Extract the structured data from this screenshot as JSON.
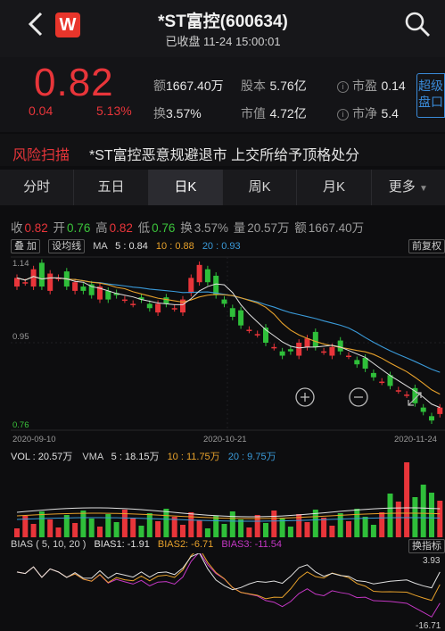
{
  "header": {
    "back_icon": "chevron-left-icon",
    "logo_text": "W",
    "title": "*ST富控(600634)",
    "subtitle": "已收盘 11-24 15:00:01",
    "search_icon": "search-icon"
  },
  "quote": {
    "price": "0.82",
    "change": "0.04",
    "change_pct": "5.13%",
    "amount_label": "额",
    "amount": "1667.40万",
    "capital_label": "股本",
    "capital": "5.76亿",
    "pe_label": "市盈",
    "pe": "0.14",
    "turnover_label": "换",
    "turnover": "3.57%",
    "mktcap_label": "市值",
    "mktcap": "4.72亿",
    "pb_label": "市净",
    "pb": "5.4",
    "super_button": "超级盘口"
  },
  "risk": {
    "label": "风险扫描",
    "text": "*ST富控恶意规避退市 上交所给予顶格处分"
  },
  "tabs": [
    "分时",
    "五日",
    "日K",
    "周K",
    "月K",
    "更多"
  ],
  "active_tab": 2,
  "ohlc": {
    "close_label": "收",
    "close": "0.82",
    "open_label": "开",
    "open": "0.76",
    "high_label": "高",
    "high": "0.82",
    "low_label": "低",
    "low": "0.76",
    "turn_label": "换",
    "turn": "3.57%",
    "vol_label": "量",
    "vol": "20.57万",
    "amt_label": "额",
    "amt": "1667.40万"
  },
  "ma_bar": {
    "btn1": "叠 加",
    "btn2": "设均线",
    "ma": "MA",
    "ma5": "5 : 0.84",
    "ma10": "10 : 0.88",
    "ma20": "20 : 0.93",
    "right_btn": "前复权"
  },
  "kline": {
    "ytop": "1.14",
    "ymid": "0.95",
    "ybot": "0.76",
    "dates": [
      "2020-09-10",
      "2020-10-21",
      "2020-11-24"
    ],
    "zoom_in_icon": "zoom-in-icon",
    "zoom_out_icon": "zoom-out-icon"
  },
  "vol_bar": {
    "vol": "VOL : 20.57万",
    "vma": "VMA",
    "vma5": "5 : 18.15万",
    "vma10": "10 : 11.75万",
    "vma20": "20 : 9.75万"
  },
  "bias_bar": {
    "title": "BIAS ( 5, 10, 20 )",
    "b1": "BIAS1: -1.91",
    "b2": "BIAS2: -6.71",
    "b3": "BIAS3: -11.54",
    "right_btn": "换指标",
    "top": "3.93",
    "bottom": "-16.71"
  },
  "colors": {
    "up": "#e8353a",
    "down": "#2fbf3a",
    "ma5": "#e0e0e0",
    "ma10": "#e7a12b",
    "ma20": "#3a9ad9",
    "bias3": "#c437c4"
  }
}
